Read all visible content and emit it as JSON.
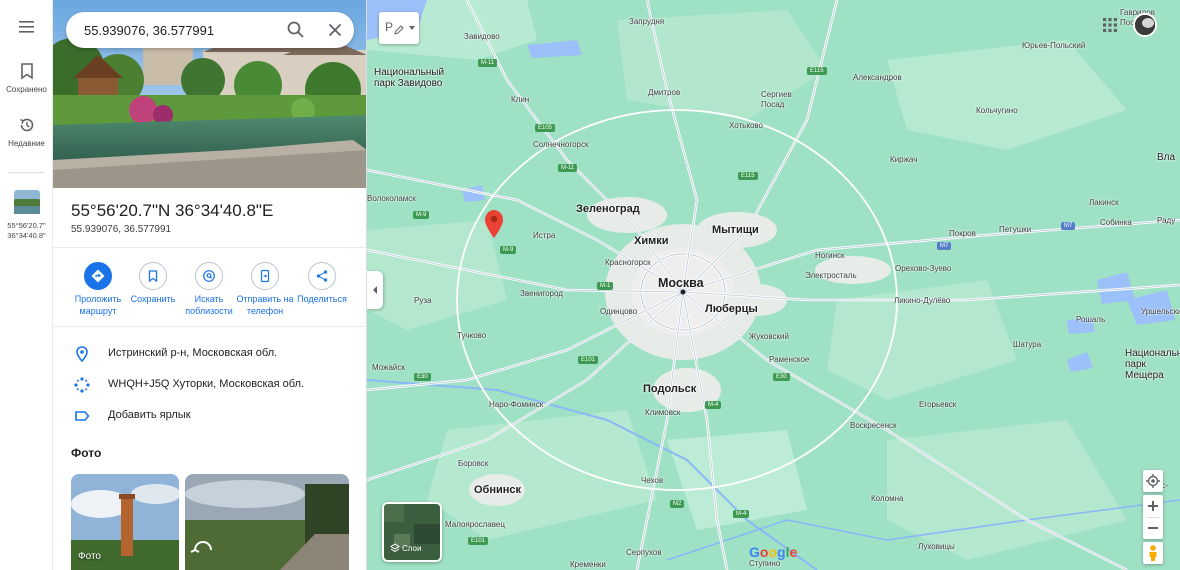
{
  "rail": {
    "saved_label": "Сохранено",
    "recent_label": "Недавние",
    "recent_place_label": "55°56'20.7\" 36°34'40.8\""
  },
  "search": {
    "query": "55.939076, 36.577991"
  },
  "place": {
    "title": "55°56'20.7\"N 36°34'40.8\"E",
    "subtitle": "55.939076, 36.577991"
  },
  "actions": [
    {
      "label": "Проложить маршрут"
    },
    {
      "label": "Сохранить"
    },
    {
      "label": "Искать поблизости"
    },
    {
      "label": "Отправить на телефон"
    },
    {
      "label": "Поделиться"
    }
  ],
  "info": {
    "address": "Истринский р-н, Московская обл.",
    "plus_code": "WHQH+J5Q Хуторки, Московская обл.",
    "add_label": "Добавить ярлык"
  },
  "photos": {
    "heading": "Фото",
    "first_label": "Фото"
  },
  "map": {
    "layers_label": "Слои",
    "brand": "Google",
    "tools_label": "Р",
    "places": [
      {
        "name": "Запрудня",
        "cls": ""
      },
      {
        "name": "Завидово",
        "cls": ""
      },
      {
        "name": "Национальный парк Завидово",
        "cls": "big"
      },
      {
        "name": "Клин",
        "cls": ""
      },
      {
        "name": "Дмитров",
        "cls": ""
      },
      {
        "name": "Сергиев Посад",
        "cls": ""
      },
      {
        "name": "Александров",
        "cls": ""
      },
      {
        "name": "Юрьев-Польский",
        "cls": ""
      },
      {
        "name": "Гаврилов Посад",
        "cls": ""
      },
      {
        "name": "Кольчугино",
        "cls": ""
      },
      {
        "name": "Хотьково",
        "cls": ""
      },
      {
        "name": "Солнечногорск",
        "cls": ""
      },
      {
        "name": "Киржач",
        "cls": ""
      },
      {
        "name": "Вла",
        "cls": "big"
      },
      {
        "name": "Волоколамск",
        "cls": ""
      },
      {
        "name": "Зеленоград",
        "cls": "major"
      },
      {
        "name": "Химки",
        "cls": "major"
      },
      {
        "name": "Мытищи",
        "cls": "major"
      },
      {
        "name": "Истра",
        "cls": ""
      },
      {
        "name": "Красногорск",
        "cls": ""
      },
      {
        "name": "Ногинск",
        "cls": ""
      },
      {
        "name": "Покров",
        "cls": ""
      },
      {
        "name": "Петушки",
        "cls": ""
      },
      {
        "name": "Лакинск",
        "cls": ""
      },
      {
        "name": "Собинка",
        "cls": ""
      },
      {
        "name": "Раду",
        "cls": ""
      },
      {
        "name": "Электросталь",
        "cls": ""
      },
      {
        "name": "Орехово-Зуево",
        "cls": ""
      },
      {
        "name": "Москва",
        "cls": "capital"
      },
      {
        "name": "Звенигород",
        "cls": ""
      },
      {
        "name": "Одинцово",
        "cls": ""
      },
      {
        "name": "Люберцы",
        "cls": "major"
      },
      {
        "name": "Руза",
        "cls": ""
      },
      {
        "name": "Ликино-Дулёво",
        "cls": ""
      },
      {
        "name": "Рошаль",
        "cls": ""
      },
      {
        "name": "Уршельский",
        "cls": ""
      },
      {
        "name": "Тучково",
        "cls": ""
      },
      {
        "name": "Жуковский",
        "cls": ""
      },
      {
        "name": "Шатура",
        "cls": ""
      },
      {
        "name": "Национальный парк Мещера",
        "cls": "big"
      },
      {
        "name": "Раменское",
        "cls": ""
      },
      {
        "name": "Можайск",
        "cls": ""
      },
      {
        "name": "Подольск",
        "cls": "major"
      },
      {
        "name": "Наро-Фоминск",
        "cls": ""
      },
      {
        "name": "Климовск",
        "cls": ""
      },
      {
        "name": "Егорьевск",
        "cls": ""
      },
      {
        "name": "Воскресенск",
        "cls": ""
      },
      {
        "name": "Боровск",
        "cls": ""
      },
      {
        "name": "Обнинск",
        "cls": "major"
      },
      {
        "name": "Чехов",
        "cls": ""
      },
      {
        "name": "Коломна",
        "cls": ""
      },
      {
        "name": "Спас-",
        "cls": ""
      },
      {
        "name": "Малоярославец",
        "cls": ""
      },
      {
        "name": "Серпухов",
        "cls": ""
      },
      {
        "name": "Ступино",
        "cls": ""
      },
      {
        "name": "Луховицы",
        "cls": ""
      },
      {
        "name": "Кременки",
        "cls": ""
      }
    ],
    "shields": [
      {
        "code": "M-11",
        "color": "green"
      },
      {
        "code": "E115",
        "color": "green"
      },
      {
        "code": "E105",
        "color": "green"
      },
      {
        "code": "M-11",
        "color": "green"
      },
      {
        "code": "E115",
        "color": "green"
      },
      {
        "code": "M-9",
        "color": "green"
      },
      {
        "code": "M-9",
        "color": "green"
      },
      {
        "code": "M7",
        "color": "blue"
      },
      {
        "code": "M7",
        "color": "blue"
      },
      {
        "code": "M-1",
        "color": "green"
      },
      {
        "code": "E30",
        "color": "green"
      },
      {
        "code": "E101",
        "color": "green"
      },
      {
        "code": "E30",
        "color": "green"
      },
      {
        "code": "M-4",
        "color": "green"
      },
      {
        "code": "M2",
        "color": "green"
      },
      {
        "code": "M-4",
        "color": "green"
      },
      {
        "code": "E101",
        "color": "green"
      }
    ]
  }
}
